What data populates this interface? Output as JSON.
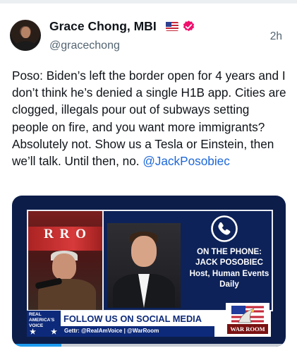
{
  "post": {
    "author_name": "Grace Chong, MBI",
    "handle": "@gracechong",
    "timestamp": "2h",
    "text": "Poso: Biden’s left the border open for 4 years and I don’t think he’s denied a single H1B app. Cities are clogged, illegals pour out of subways setting people on fire, and you want more immigrants? Absolutely not. Show us a Tesla or Einstein, then we’ll talk. Until then, no. ",
    "mention": "@JackPosobiec"
  },
  "icons": {
    "flag": "us-flag-icon",
    "verified": "verified-badge-icon",
    "phone": "phone-icon"
  },
  "colors": {
    "mention": "#1d67d8",
    "verified_badge": "#f00f6d",
    "media_background": "#0c1d4a",
    "banner_blue": "#0d2a7a"
  },
  "media": {
    "left_sign": "R R O",
    "caption": {
      "line1": "ON THE PHONE:",
      "line2": "JACK POSOBIEC",
      "line3": "Host, Human Events",
      "line4": "Daily"
    },
    "banner": {
      "logo_line1": "REAL",
      "logo_line2": "AMERICA'S",
      "logo_line3": "VOICE",
      "title": "FOLLOW US ON SOCIAL MEDIA",
      "subtitle": "Gettr: @RealAmVoice | @WarRoom"
    },
    "warroom_logo": "WAR ROOM",
    "progress_fraction": 0.18
  }
}
